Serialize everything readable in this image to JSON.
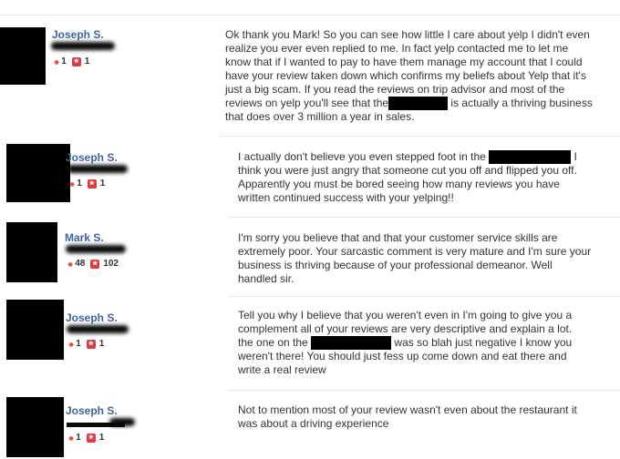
{
  "comments": [
    {
      "name": "Joseph S.",
      "friends": "1",
      "reviews": "1",
      "text_a": "Ok thank you Mark! So you can see how little I care about yelp I didn't even realize you ever even replied to me. In fact yelp contacted me to let me know that if I wanted to pay to have them manage my account that I could have your review taken down which confirms my beliefs about Yelp that it's just a big scam. If you read the reviews on trip advisor and most of the reviews on yelp you'll see that the",
      "text_b": "is actually a thriving business that does over 3 million a year in sales."
    },
    {
      "name": "Joseph S.",
      "friends": "1",
      "reviews": "1",
      "text_a": "I actually don't believe you even stepped foot in the",
      "text_b": "I think you were just angry that someone cut you off and flipped you off. Apparently you must be bored seeing how many reviews you have written continued success with your yelping!!"
    },
    {
      "name": "Mark S.",
      "friends": "48",
      "reviews": "102",
      "text_a": "I'm sorry you believe that and that your customer service skills are extremely poor.  Your sarcastic comment is very mature and I'm sure your business is thriving because of your professional demeanor.   Well handled sir."
    },
    {
      "name": "Joseph S.",
      "friends": "1",
      "reviews": "1",
      "text_a": "Tell you why I believe that you weren't even in I'm going to give you a complement all of your reviews are very descriptive and explain a lot. the one on the",
      "text_b": "was so blah just negative I know you weren't there! You should just fess up come down and eat there and write a real review"
    },
    {
      "name": "Joseph S.",
      "friends": "1",
      "reviews": "1",
      "text_a": "Not to mention most of your review wasn't even about the restaurant it was about a driving experience"
    }
  ],
  "colors": {
    "name": "#3b65a7",
    "friend_icon": "#e8552d",
    "review_icon": "#e0393e"
  },
  "icons": {
    "friends": "friends-icon",
    "reviews": "review-star-icon"
  }
}
